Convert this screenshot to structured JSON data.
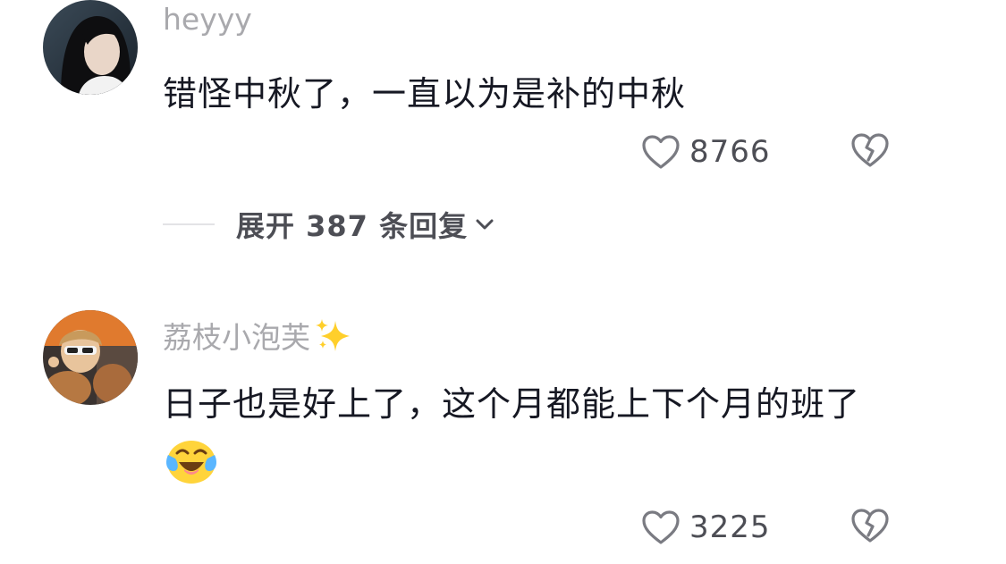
{
  "comments": [
    {
      "username": "heyyy",
      "text": "错怪中秋了，一直以为是补的中秋",
      "likes": "8766",
      "avatar_icon": "user-avatar-woman",
      "replies_label": "展开 387 条回复"
    },
    {
      "username": "荔枝小泡芙",
      "username_badge_icon": "sparkles-icon",
      "text": "日子也是好上了，这个月都能上下个月的班了",
      "emoji_icon": "crying-laughing-emoji",
      "likes": "3225",
      "avatar_icon": "user-avatar-child"
    }
  ],
  "colors": {
    "text_primary": "#161823",
    "text_secondary": "#a9a9ad",
    "count": "#4d4e55",
    "icon_stroke": "#7a7b82"
  }
}
